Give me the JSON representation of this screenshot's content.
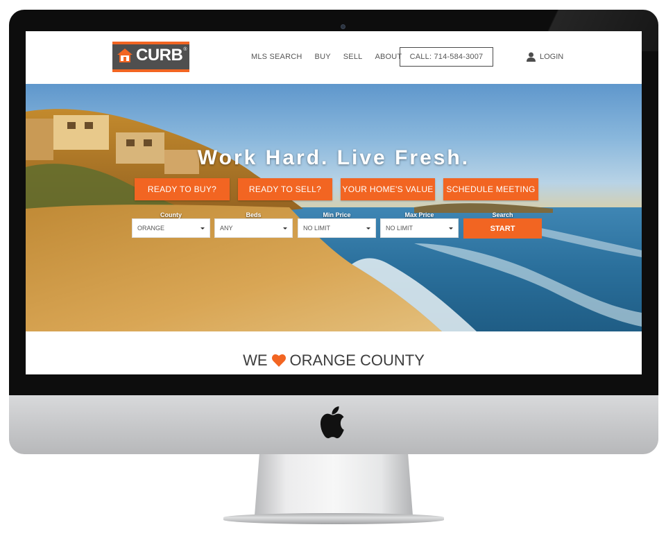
{
  "logo": {
    "text": "CURB",
    "reg": "®"
  },
  "nav": {
    "items": [
      "MLS SEARCH",
      "BUY",
      "SELL",
      "ABOUT"
    ],
    "call_label": "CALL: 714-584-3007",
    "login_label": "LOGIN"
  },
  "hero": {
    "title": "Work Hard. Live Fresh.",
    "cta": [
      "READY TO BUY?",
      "READY TO SELL?",
      "YOUR HOME'S VALUE",
      "SCHEDULE MEETING"
    ]
  },
  "search": {
    "fields": [
      {
        "label": "County",
        "value": "ORANGE"
      },
      {
        "label": "Beds",
        "value": "ANY"
      },
      {
        "label": "Min Price",
        "value": "NO LIMIT"
      },
      {
        "label": "Max Price",
        "value": "NO LIMIT"
      }
    ],
    "submit_label": "Search",
    "submit_button": "START"
  },
  "tagline": {
    "before": "WE",
    "after": "ORANGE COUNTY"
  },
  "colors": {
    "accent": "#f26522",
    "logo_bg": "#4f4f4f",
    "text": "#555555"
  },
  "icons": {
    "login": "user-icon",
    "love": "heart-icon",
    "brand": "apple-logo-icon",
    "logo": "house-icon"
  }
}
